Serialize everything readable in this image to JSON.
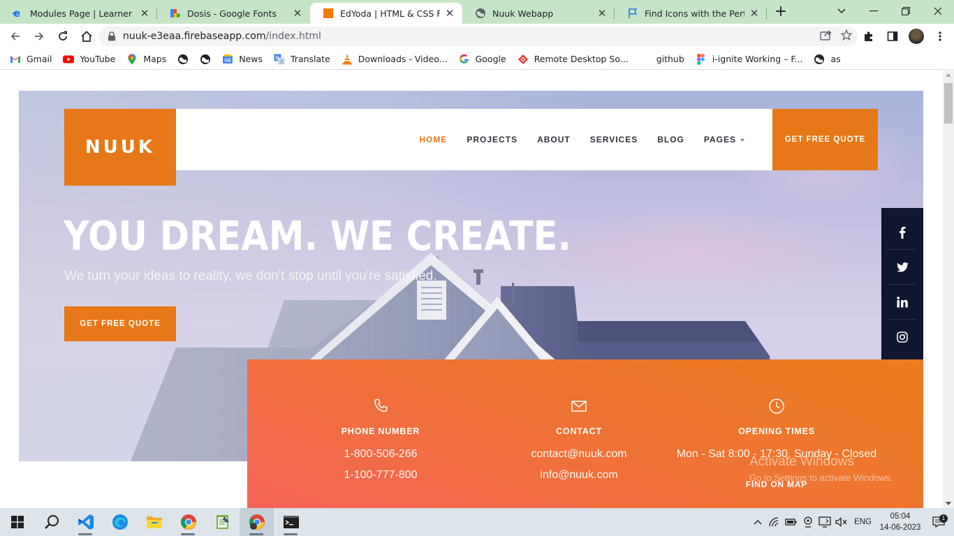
{
  "browser": {
    "tabs": [
      {
        "title": "Modules Page | Learner",
        "icon": "edyoda-e-icon",
        "active": false
      },
      {
        "title": "Dosis - Google Fonts",
        "icon": "google-fonts-icon",
        "active": false
      },
      {
        "title": "EdYoda | HTML & CSS Final P",
        "icon": "orange-square-icon",
        "active": true
      },
      {
        "title": "Nuuk Webapp",
        "icon": "globe-icon",
        "active": false
      },
      {
        "title": "Find Icons with the Perfect Lo",
        "icon": "flag-icon",
        "active": false
      }
    ],
    "url_host": "nuuk-e3eaa.firebaseapp.com",
    "url_path": "/index.html",
    "bookmarks": [
      {
        "label": "Gmail",
        "icon": "gmail-icon"
      },
      {
        "label": "YouTube",
        "icon": "youtube-icon"
      },
      {
        "label": "Maps",
        "icon": "maps-pin-icon"
      },
      {
        "label": "",
        "icon": "globe-icon"
      },
      {
        "label": "",
        "icon": "globe-icon"
      },
      {
        "label": "News",
        "icon": "google-news-icon"
      },
      {
        "label": "Translate",
        "icon": "translate-icon"
      },
      {
        "label": "Downloads - Video...",
        "icon": "vlc-cone-icon"
      },
      {
        "label": "Google",
        "icon": "google-g-icon"
      },
      {
        "label": "Remote Desktop So...",
        "icon": "remote-desktop-icon"
      },
      {
        "label": "github",
        "icon": "blank-icon"
      },
      {
        "label": "i-ignite Working – F...",
        "icon": "figma-icon"
      },
      {
        "label": "as",
        "icon": "globe-icon"
      }
    ]
  },
  "site": {
    "logo": "NUUK",
    "nav": [
      {
        "label": "HOME",
        "active": true,
        "dropdown": false
      },
      {
        "label": "PROJECTS",
        "active": false,
        "dropdown": false
      },
      {
        "label": "ABOUT",
        "active": false,
        "dropdown": false
      },
      {
        "label": "SERVICES",
        "active": false,
        "dropdown": false
      },
      {
        "label": "BLOG",
        "active": false,
        "dropdown": false
      },
      {
        "label": "PAGES",
        "active": false,
        "dropdown": true
      }
    ],
    "nav_cta": "GET FREE QUOTE",
    "hero_title": "YOU DREAM. WE CREATE.",
    "hero_subtitle": "We turn your ideas to reality, we don't stop until you're satisfied.",
    "hero_button": "GET FREE QUOTE",
    "social": [
      "facebook-icon",
      "twitter-icon",
      "linkedin-icon",
      "instagram-icon"
    ],
    "contact": {
      "phone": {
        "title": "PHONE NUMBER",
        "lines": [
          "1-800-506-266",
          "1-100-777-800"
        ]
      },
      "email": {
        "title": "CONTACT",
        "lines": [
          "contact@nuuk.com",
          "info@nuuk.com"
        ]
      },
      "hours": {
        "title": "OPENING TIMES",
        "lines": [
          "Mon - Sat 8:00 - 17:30, Sunday - Closed"
        ],
        "link": "FIND ON MAP"
      }
    },
    "colors": {
      "accent": "#e77817",
      "dark": "#101630",
      "nav_text": "#2f2f3a"
    }
  },
  "watermark": {
    "line1": "Activate Windows",
    "line2": "Go to Settings to activate Windows."
  },
  "taskbar": {
    "apps": [
      "windows-start-icon",
      "search-icon",
      "vscode-icon",
      "edge-icon",
      "file-explorer-icon",
      "chrome-icon",
      "notepad-icon",
      "chrome-profile-icon",
      "terminal-icon"
    ],
    "language": "ENG",
    "time": "05:04",
    "date": "14-06-2023",
    "notifications": "1"
  }
}
